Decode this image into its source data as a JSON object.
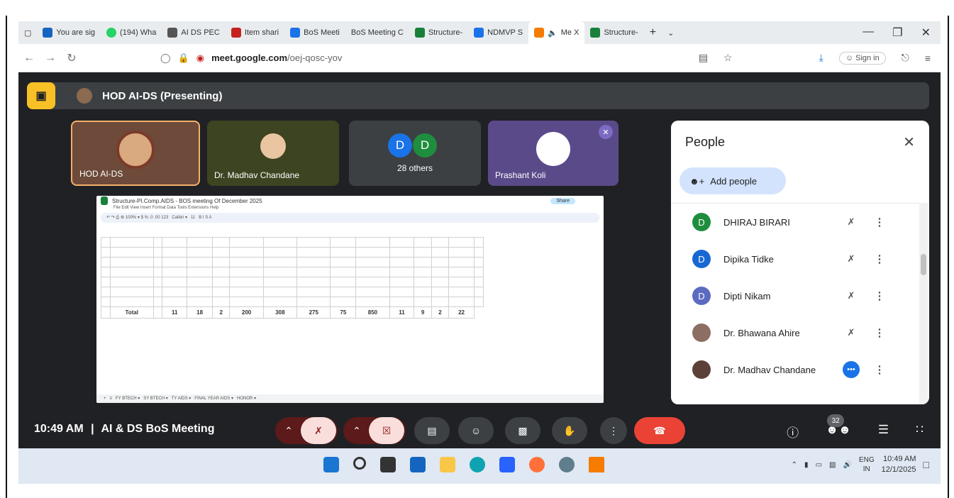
{
  "browser": {
    "tabs": [
      {
        "label": "You are sig",
        "color": "#1565c0"
      },
      {
        "label": "(194) Wha",
        "color": "#25d366"
      },
      {
        "label": "AI DS PEC",
        "color": "#555555"
      },
      {
        "label": "Item shari",
        "color": "#c5221f"
      },
      {
        "label": "BoS Meeti",
        "color": "#1a73e8"
      },
      {
        "label": "BoS Meeting C",
        "color": "#fbbc04"
      },
      {
        "label": "Structure-",
        "color": "#188038"
      },
      {
        "label": "NDMVP S",
        "color": "#1a73e8"
      },
      {
        "label": "Me X",
        "color": "#f57c00"
      },
      {
        "label": "Structure-",
        "color": "#188038"
      }
    ],
    "url_host": "meet.google.com",
    "url_path": "/oej-qosc-yov",
    "signin_label": "Sign in"
  },
  "meet": {
    "presenting_label": "HOD AI-DS (Presenting)",
    "tiles": {
      "hod": "HOD AI-DS",
      "madhav": "Dr. Madhav Chandane",
      "others_label": "28 others",
      "others_chip": "D",
      "prashant": "Prashant Koli"
    },
    "sheet": {
      "title": "Structure-PI.Comp.AIDS - BOS meeting Of December 2025",
      "menu": "File  Edit  View  Insert  Format  Data  Tools  Extensions  Help",
      "share": "Share",
      "rows": [
        [
          "",
          "",
          "",
          "",
          "",
          "",
          "",
          "",
          "",
          "",
          "",
          "",
          "",
          "",
          "",
          ""
        ],
        [
          "",
          "",
          "",
          "",
          "",
          "",
          "",
          "",
          "",
          "",
          "",
          "",
          "",
          "",
          "",
          ""
        ],
        [
          "",
          "",
          "",
          "",
          "",
          "",
          "",
          "",
          "",
          "",
          "",
          "",
          "",
          "",
          "",
          ""
        ],
        [
          "",
          "",
          "",
          "",
          "",
          "",
          "",
          "",
          "",
          "",
          "",
          "",
          "",
          "",
          "",
          ""
        ],
        [
          "",
          "",
          "",
          "",
          "",
          "",
          "",
          "",
          "",
          "",
          "",
          "",
          "",
          "",
          "",
          ""
        ],
        [
          "",
          "",
          "",
          "",
          "",
          "",
          "",
          "",
          "",
          "",
          "",
          "",
          "",
          "",
          "",
          ""
        ],
        [
          "",
          "",
          "",
          "",
          "",
          "",
          "",
          "",
          "",
          "",
          "",
          "",
          "",
          "",
          "",
          ""
        ]
      ],
      "total_row": [
        "",
        "Total",
        "",
        "11",
        "18",
        "2",
        "200",
        "308",
        "275",
        "75",
        "850",
        "11",
        "9",
        "2",
        "22"
      ]
    },
    "people": {
      "title": "People",
      "add_label": "Add people",
      "list": [
        {
          "name": "DHIRAJ BIRARI",
          "initial": "D",
          "color": "#1e8e3e"
        },
        {
          "name": "Dipika Tidke",
          "initial": "D",
          "color": "#1967d2"
        },
        {
          "name": "Dipti Nikam",
          "initial": "D",
          "color": "#5c6bc0"
        },
        {
          "name": "Dr. Bhawana Ahire",
          "initial": "",
          "color": "#8d6e63"
        },
        {
          "name": "Dr. Madhav Chandane",
          "initial": "",
          "color": "#5d4037"
        }
      ]
    },
    "controls": {
      "time": "10:49 AM",
      "separator": "|",
      "meeting_name": "AI & DS BoS Meeting",
      "people_count": "32"
    }
  },
  "taskbar": {
    "lang_top": "ENG",
    "lang_bottom": "IN",
    "time": "10:49 AM",
    "date": "12/1/2025"
  }
}
